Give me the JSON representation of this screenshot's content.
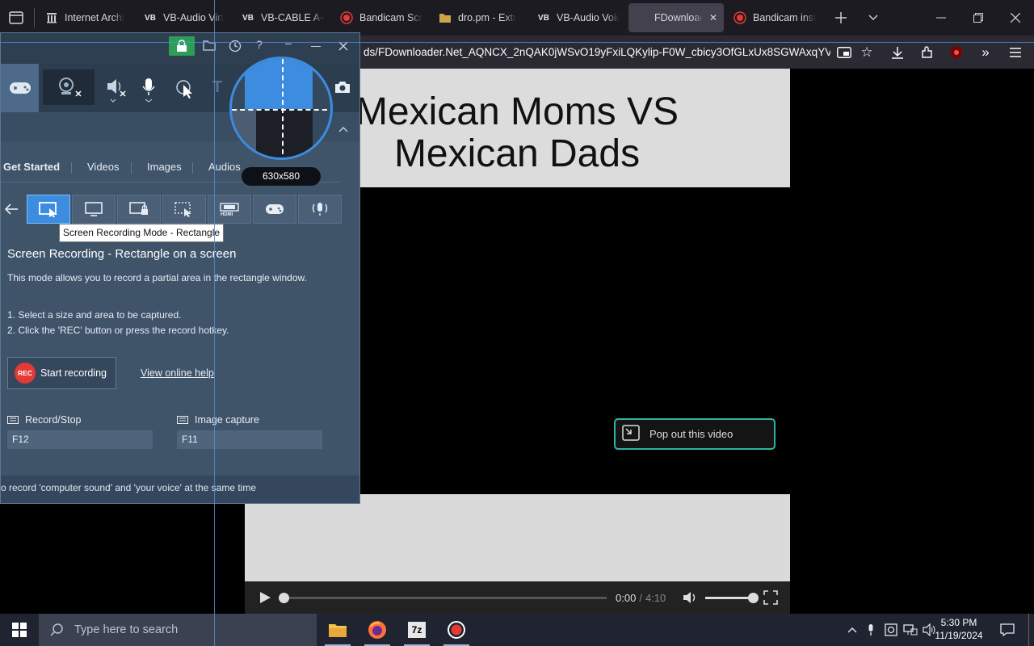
{
  "browser": {
    "tabs": [
      {
        "label": "Internet Archi",
        "icon": "archive-icon"
      },
      {
        "label": "VB-Audio Virt",
        "icon": "vb-logo-icon"
      },
      {
        "label": "VB-CABLE A+",
        "icon": "vb-logo-icon"
      },
      {
        "label": "Bandicam Scr",
        "icon": "bandicam-icon"
      },
      {
        "label": "dro.pm - Extr",
        "icon": "folder-icon"
      },
      {
        "label": "VB-Audio Voic",
        "icon": "vb-logo-icon"
      },
      {
        "label": "FDownloader.N",
        "icon": "none",
        "active": true
      },
      {
        "label": "Bandicam inst",
        "icon": "bandicam-icon"
      }
    ],
    "url": "ds/FDownloader.Net_AQNCX_2nQAK0jWSvO19yFxiLQKylip-F0W_cbicy3OfGLxUx8SGWAxqYVN"
  },
  "video": {
    "title_line1": "Mexican Moms VS",
    "title_line2": "Mexican Dads",
    "popout_label": "Pop out this video",
    "time_current": "0:00",
    "time_sep": "/",
    "time_total": "4:10",
    "progress_fraction": 0.0,
    "volume_fraction": 1.0
  },
  "bandicam": {
    "tabs": [
      "Get Started",
      "Videos",
      "Images",
      "Audios"
    ],
    "magnifier_size": "630x580",
    "tooltip": "Screen Recording Mode - Rectangle",
    "heading": "Screen Recording - Rectangle on a screen",
    "description": "This mode allows you to record a partial area in the rectangle window.",
    "step1": "1. Select a size and area to be captured.",
    "step2": "2. Click the 'REC' button or press the record hotkey.",
    "rec_badge": "REC",
    "start_label": "Start recording",
    "help_link": "View online help",
    "record_stop_label": "Record/Stop",
    "record_stop_key": "F12",
    "image_capture_label": "Image capture",
    "image_capture_key": "F11",
    "footer": "o record 'computer sound' and 'your voice' at the same time",
    "hdmi_label": "HDMI"
  },
  "taskbar": {
    "search_placeholder": "Type here to search",
    "time": "5:30 PM",
    "date": "11/19/2024",
    "apps": [
      "file-explorer-icon",
      "firefox-icon",
      "7zip-icon",
      "bandicam-icon"
    ],
    "sevenzip_label": "7z"
  },
  "colors": {
    "accent": "#3c8de0",
    "bandicam_panel": "#3f5369",
    "taskbar": "#1f2430",
    "popout_border": "#2bb5a4",
    "rec_red": "#e53935"
  }
}
